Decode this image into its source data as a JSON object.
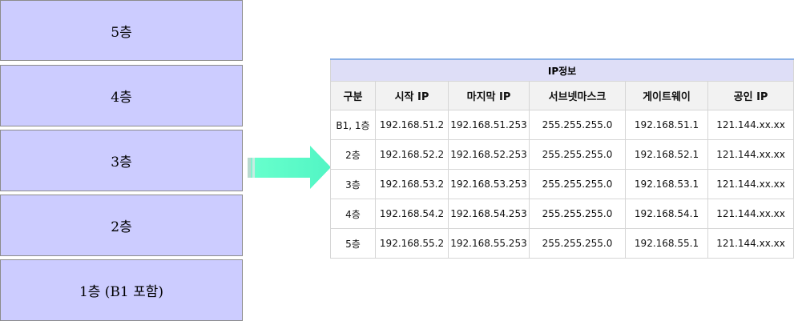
{
  "floors": [
    {
      "label": "5층"
    },
    {
      "label": "4층"
    },
    {
      "label": "3층"
    },
    {
      "label": "2층"
    },
    {
      "label": "1층 (B1 포함)"
    }
  ],
  "colors": {
    "floor_fill": "#ccccff",
    "arrow_fill": "#66ffcc",
    "table_title_bg": "#dedef7"
  },
  "table": {
    "title": "IP정보",
    "headers": [
      "구분",
      "시작 IP",
      "마지막 IP",
      "서브넷마스크",
      "게이트웨이",
      "공인 IP"
    ],
    "rows": [
      [
        "B1, 1층",
        "192.168.51.2",
        "192.168.51.253",
        "255.255.255.0",
        "192.168.51.1",
        "121.144.xx.xx"
      ],
      [
        "2층",
        "192.168.52.2",
        "192.168.52.253",
        "255.255.255.0",
        "192.168.52.1",
        "121.144.xx.xx"
      ],
      [
        "3층",
        "192.168.53.2",
        "192.168.53.253",
        "255.255.255.0",
        "192.168.53.1",
        "121.144.xx.xx"
      ],
      [
        "4층",
        "192.168.54.2",
        "192.168.54.253",
        "255.255.255.0",
        "192.168.54.1",
        "121.144.xx.xx"
      ],
      [
        "5층",
        "192.168.55.2",
        "192.168.55.253",
        "255.255.255.0",
        "192.168.55.1",
        "121.144.xx.xx"
      ]
    ]
  }
}
